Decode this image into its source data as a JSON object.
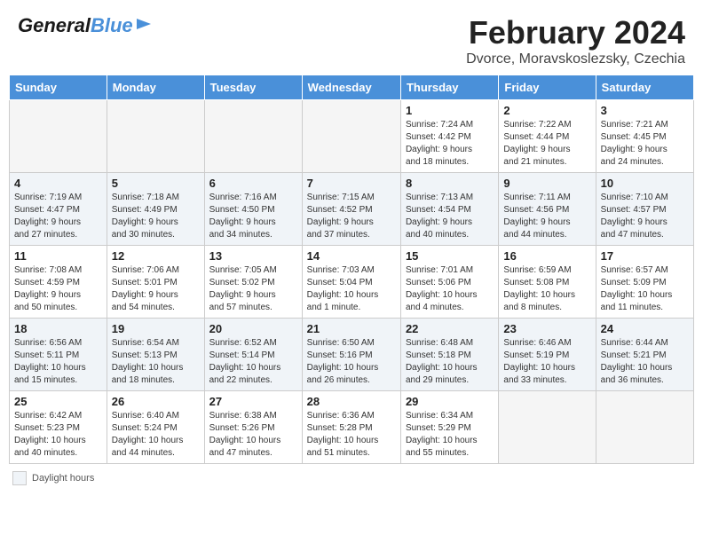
{
  "header": {
    "logo_general": "General",
    "logo_blue": "Blue",
    "month_title": "February 2024",
    "location": "Dvorce, Moravskoslezsky, Czechia"
  },
  "weekdays": [
    "Sunday",
    "Monday",
    "Tuesday",
    "Wednesday",
    "Thursday",
    "Friday",
    "Saturday"
  ],
  "weeks": [
    {
      "shaded": false,
      "days": [
        {
          "num": "",
          "info": ""
        },
        {
          "num": "",
          "info": ""
        },
        {
          "num": "",
          "info": ""
        },
        {
          "num": "",
          "info": ""
        },
        {
          "num": "1",
          "info": "Sunrise: 7:24 AM\nSunset: 4:42 PM\nDaylight: 9 hours\nand 18 minutes."
        },
        {
          "num": "2",
          "info": "Sunrise: 7:22 AM\nSunset: 4:44 PM\nDaylight: 9 hours\nand 21 minutes."
        },
        {
          "num": "3",
          "info": "Sunrise: 7:21 AM\nSunset: 4:45 PM\nDaylight: 9 hours\nand 24 minutes."
        }
      ]
    },
    {
      "shaded": true,
      "days": [
        {
          "num": "4",
          "info": "Sunrise: 7:19 AM\nSunset: 4:47 PM\nDaylight: 9 hours\nand 27 minutes."
        },
        {
          "num": "5",
          "info": "Sunrise: 7:18 AM\nSunset: 4:49 PM\nDaylight: 9 hours\nand 30 minutes."
        },
        {
          "num": "6",
          "info": "Sunrise: 7:16 AM\nSunset: 4:50 PM\nDaylight: 9 hours\nand 34 minutes."
        },
        {
          "num": "7",
          "info": "Sunrise: 7:15 AM\nSunset: 4:52 PM\nDaylight: 9 hours\nand 37 minutes."
        },
        {
          "num": "8",
          "info": "Sunrise: 7:13 AM\nSunset: 4:54 PM\nDaylight: 9 hours\nand 40 minutes."
        },
        {
          "num": "9",
          "info": "Sunrise: 7:11 AM\nSunset: 4:56 PM\nDaylight: 9 hours\nand 44 minutes."
        },
        {
          "num": "10",
          "info": "Sunrise: 7:10 AM\nSunset: 4:57 PM\nDaylight: 9 hours\nand 47 minutes."
        }
      ]
    },
    {
      "shaded": false,
      "days": [
        {
          "num": "11",
          "info": "Sunrise: 7:08 AM\nSunset: 4:59 PM\nDaylight: 9 hours\nand 50 minutes."
        },
        {
          "num": "12",
          "info": "Sunrise: 7:06 AM\nSunset: 5:01 PM\nDaylight: 9 hours\nand 54 minutes."
        },
        {
          "num": "13",
          "info": "Sunrise: 7:05 AM\nSunset: 5:02 PM\nDaylight: 9 hours\nand 57 minutes."
        },
        {
          "num": "14",
          "info": "Sunrise: 7:03 AM\nSunset: 5:04 PM\nDaylight: 10 hours\nand 1 minute."
        },
        {
          "num": "15",
          "info": "Sunrise: 7:01 AM\nSunset: 5:06 PM\nDaylight: 10 hours\nand 4 minutes."
        },
        {
          "num": "16",
          "info": "Sunrise: 6:59 AM\nSunset: 5:08 PM\nDaylight: 10 hours\nand 8 minutes."
        },
        {
          "num": "17",
          "info": "Sunrise: 6:57 AM\nSunset: 5:09 PM\nDaylight: 10 hours\nand 11 minutes."
        }
      ]
    },
    {
      "shaded": true,
      "days": [
        {
          "num": "18",
          "info": "Sunrise: 6:56 AM\nSunset: 5:11 PM\nDaylight: 10 hours\nand 15 minutes."
        },
        {
          "num": "19",
          "info": "Sunrise: 6:54 AM\nSunset: 5:13 PM\nDaylight: 10 hours\nand 18 minutes."
        },
        {
          "num": "20",
          "info": "Sunrise: 6:52 AM\nSunset: 5:14 PM\nDaylight: 10 hours\nand 22 minutes."
        },
        {
          "num": "21",
          "info": "Sunrise: 6:50 AM\nSunset: 5:16 PM\nDaylight: 10 hours\nand 26 minutes."
        },
        {
          "num": "22",
          "info": "Sunrise: 6:48 AM\nSunset: 5:18 PM\nDaylight: 10 hours\nand 29 minutes."
        },
        {
          "num": "23",
          "info": "Sunrise: 6:46 AM\nSunset: 5:19 PM\nDaylight: 10 hours\nand 33 minutes."
        },
        {
          "num": "24",
          "info": "Sunrise: 6:44 AM\nSunset: 5:21 PM\nDaylight: 10 hours\nand 36 minutes."
        }
      ]
    },
    {
      "shaded": false,
      "days": [
        {
          "num": "25",
          "info": "Sunrise: 6:42 AM\nSunset: 5:23 PM\nDaylight: 10 hours\nand 40 minutes."
        },
        {
          "num": "26",
          "info": "Sunrise: 6:40 AM\nSunset: 5:24 PM\nDaylight: 10 hours\nand 44 minutes."
        },
        {
          "num": "27",
          "info": "Sunrise: 6:38 AM\nSunset: 5:26 PM\nDaylight: 10 hours\nand 47 minutes."
        },
        {
          "num": "28",
          "info": "Sunrise: 6:36 AM\nSunset: 5:28 PM\nDaylight: 10 hours\nand 51 minutes."
        },
        {
          "num": "29",
          "info": "Sunrise: 6:34 AM\nSunset: 5:29 PM\nDaylight: 10 hours\nand 55 minutes."
        },
        {
          "num": "",
          "info": ""
        },
        {
          "num": "",
          "info": ""
        }
      ]
    }
  ],
  "footer": {
    "daylight_label": "Daylight hours"
  }
}
